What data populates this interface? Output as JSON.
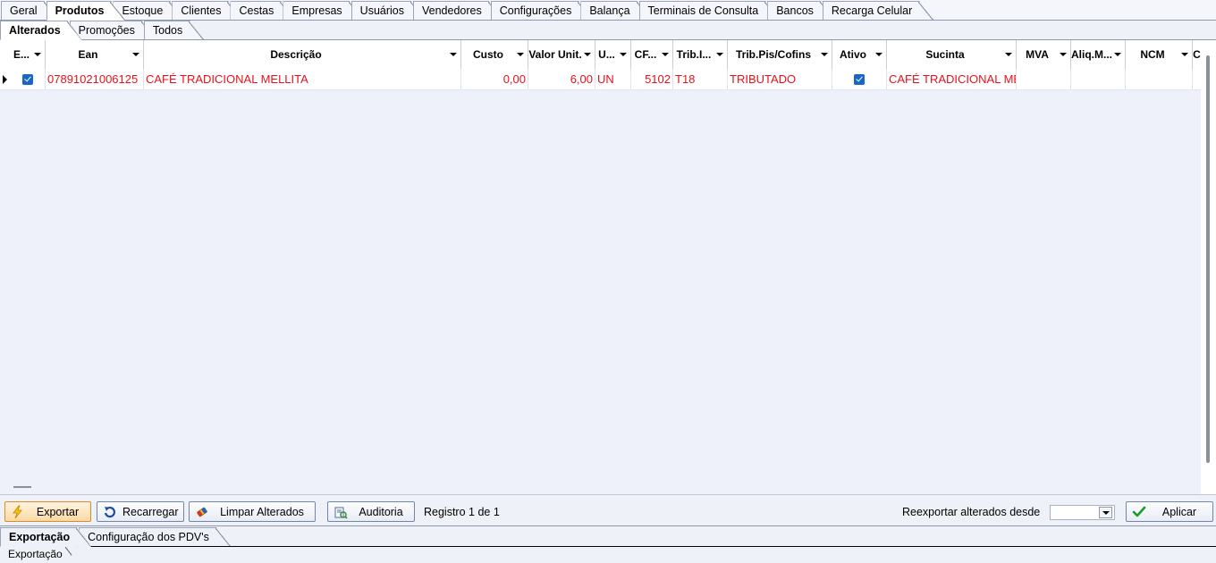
{
  "main_tabs": [
    {
      "label": "Geral",
      "active": false
    },
    {
      "label": "Produtos",
      "active": true
    },
    {
      "label": "Estoque",
      "active": false
    },
    {
      "label": "Clientes",
      "active": false
    },
    {
      "label": "Cestas",
      "active": false
    },
    {
      "label": "Empresas",
      "active": false
    },
    {
      "label": "Usuários",
      "active": false
    },
    {
      "label": "Vendedores",
      "active": false
    },
    {
      "label": "Configurações",
      "active": false
    },
    {
      "label": "Balança",
      "active": false
    },
    {
      "label": "Terminais de Consulta",
      "active": false
    },
    {
      "label": "Bancos",
      "active": false
    },
    {
      "label": "Recarga Celular",
      "active": false
    }
  ],
  "sub_tabs": [
    {
      "label": "Alterados",
      "active": true
    },
    {
      "label": "Promoções",
      "active": false
    },
    {
      "label": "Todos",
      "active": false
    }
  ],
  "grid": {
    "columns": [
      "E...",
      "Ean",
      "Descrição",
      "Custo",
      "Valor Unit.",
      "U...",
      "CF...",
      "Trib.I...",
      "Trib.Pis/Cofins",
      "Ativo",
      "Sucinta",
      "MVA",
      "Aliq.M...",
      "NCM",
      "C"
    ],
    "rows": [
      {
        "exportar_checked": true,
        "ean": "07891021006125",
        "descricao": "CAFÉ TRADICIONAL MELLITA",
        "custo": "0,00",
        "valor_unit": "6,00",
        "unidade": "UN",
        "cfop": "5102",
        "trib_icms": "T18",
        "trib_pis_cofins": "TRIBUTADO",
        "ativo_checked": true,
        "sucinta": "CAFÉ TRADICIONAL MELLITA",
        "mva": "",
        "aliq_m": "",
        "ncm": ""
      }
    ],
    "text_color": "#e8111b"
  },
  "toolbar": {
    "exportar_label": "Exportar",
    "recarregar_label": "Recarregar",
    "limpar_label": "Limpar Alterados",
    "auditoria_label": "Auditoria",
    "registro_text": "Registro 1 de 1",
    "reexportar_label": "Reexportar alterados desde",
    "date_value": "",
    "aplicar_label": "Aplicar"
  },
  "bottom_tabs": [
    {
      "label": "Exportação",
      "active": true
    },
    {
      "label": "Configuração dos PDV's",
      "active": false
    }
  ],
  "bottom_sub_tab": "Exportação",
  "icons": {
    "exportar": "lightning-icon",
    "recarregar": "refresh-icon",
    "limpar": "eraser-icon",
    "auditoria": "audit-icon",
    "aplicar": "check-icon"
  }
}
